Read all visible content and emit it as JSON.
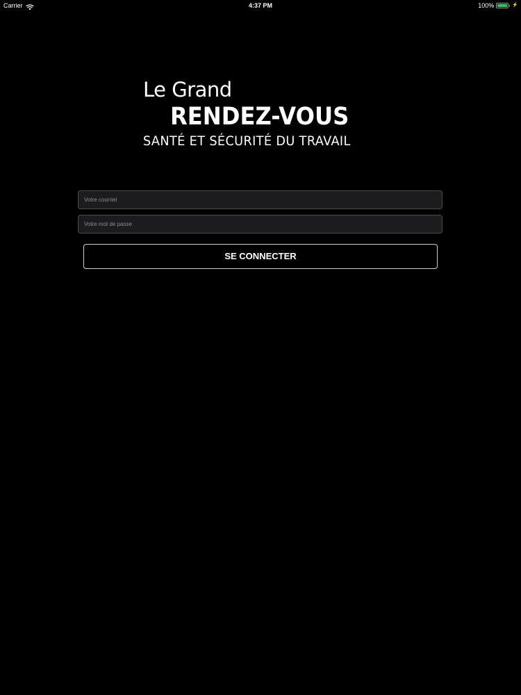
{
  "status_bar": {
    "carrier": "Carrier",
    "time": "4:37 PM",
    "battery": "100%",
    "battery_level": 1.0,
    "battery_color": "#34c759",
    "icons": [
      "wifi-icon",
      "battery-icon",
      "charging-icon"
    ]
  },
  "logo": {
    "line1": "Le Grand",
    "line2": "RENDEZ-VOUS",
    "line3": "SANTÉ ET SÉCURITÉ DU TRAVAIL"
  },
  "login_form": {
    "email": {
      "value": "",
      "placeholder": "Votre courriel"
    },
    "password": {
      "value": "",
      "placeholder": "Votre mot de passe"
    },
    "submit_label": "SE CONNECTER"
  },
  "colors": {
    "background": "#000000",
    "text": "#ffffff",
    "input_background": "#1c1c1e",
    "input_border": "#4a4a4a",
    "button_border": "#d0d0d0"
  }
}
